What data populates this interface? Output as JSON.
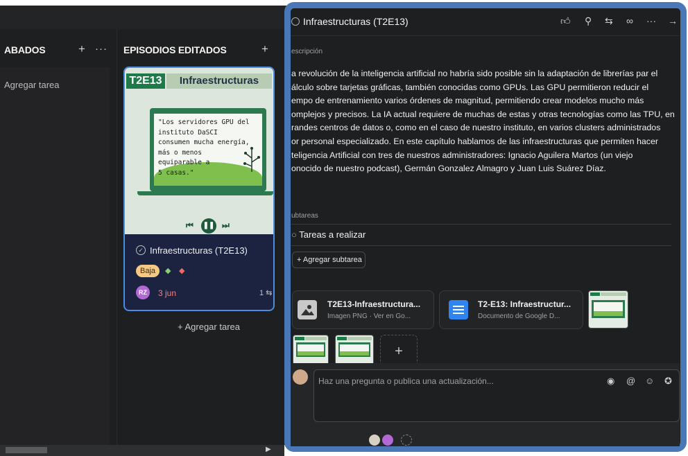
{
  "board": {
    "col1_title": "ABADOS",
    "col1_add_task": "Agregar tarea",
    "col2_title": "EPISODIOS EDITADOS",
    "plus": "+",
    "dots": "···",
    "add_task": "+ Agregar tarea"
  },
  "card": {
    "cover_code": "T2E13",
    "cover_title": "Infraestructuras",
    "quote": "\"Los servidores GPU del\ninstituto DaSCI\nconsumen mucha energía,\nmás o menos\nequiparable a\n5 casas.\"",
    "task_name": "Infraestructuras (T2E13)",
    "priority": "Baja",
    "assignee_initials": "RZ",
    "due_date": "3 jun",
    "subtasks_count": "1"
  },
  "panel": {
    "title": "Infraestructuras (T2E13)",
    "description_label": "escripción",
    "description_lines": [
      "a revolución de la inteligencia artificial no habría sido posible sin la adaptación de librerías par el",
      "álculo sobre tarjetas gráficas, también conocidas como GPUs. Las GPU permitieron reducir el",
      "empo de entrenamiento varios órdenes de magnitud, permitiendo crear modelos mucho más",
      "omplejos y precisos. La IA actual requiere de muchas de estas y otras tecnologías como las TPU, en",
      "randes centros de datos o, como en el caso de nuestro instituto, en varios clusters administrados",
      "or personal especializado. En este capítulo hablamos de las infraestructuras que permiten hacer",
      "teligencia Artificial con tres de nuestros administradores: Ignacio Aguilera Martos (un viejo",
      "onocido de nuestro podcast), Germán Gonzalez Almagro y Juan Luis Suárez Díaz."
    ],
    "subtasks_label": "ubtareas",
    "subtask_item": "Tareas a realizar",
    "add_subtask": "+ Agregar subtarea",
    "attachments": [
      {
        "name": "T2E13-Infraestructura...",
        "meta": "Imagen PNG · Ver en Go..."
      },
      {
        "name": "T2-E13: Infraestructur...",
        "meta": "Documento de Google D..."
      }
    ],
    "add_attachment": "+",
    "comment_placeholder": "Haz una pregunta o publica una actualización..."
  },
  "colors": {
    "accent_border": "#4a77b6",
    "card_border": "#4b8ee0",
    "panel_bg": "#1e1f21",
    "due_date": "#f08080"
  }
}
